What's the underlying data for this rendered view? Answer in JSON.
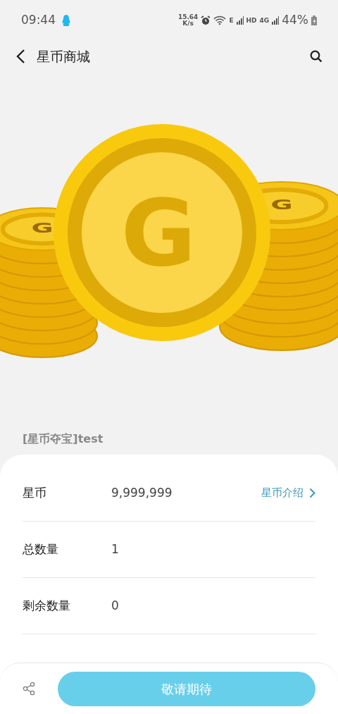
{
  "status_bar": {
    "time": "09:44",
    "net_speed": "15.64",
    "net_speed_unit": "K/s",
    "sim_label": "E",
    "hd_label": "HD",
    "network_type": "4G",
    "battery": "44%"
  },
  "header": {
    "title": "星币商城"
  },
  "coin_marks": [
    "G",
    "G",
    "G"
  ],
  "product": {
    "title": "[星币夺宝]test"
  },
  "details": [
    {
      "kind": "text",
      "label": "星币",
      "value": "9,999,999",
      "link": "星币介绍"
    },
    {
      "kind": "text",
      "label": "总数量",
      "value": "1"
    },
    {
      "kind": "text",
      "label": "剩余数量",
      "value": "0"
    }
  ],
  "action": {
    "label": "敬请期待"
  }
}
